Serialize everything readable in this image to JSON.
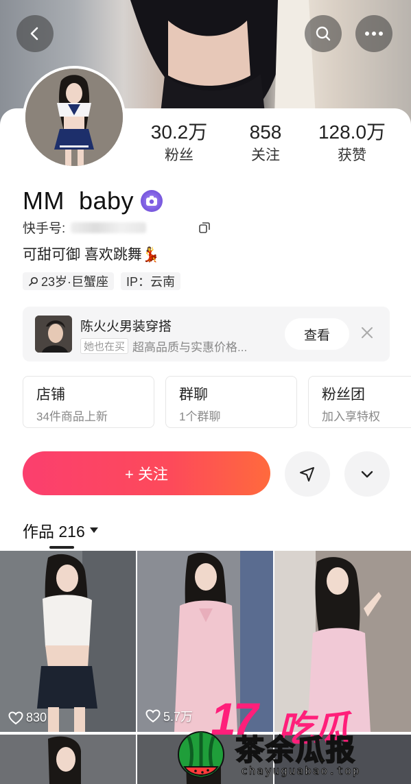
{
  "nav": {
    "back_icon": "chevron-left-icon",
    "search_icon": "search-icon",
    "more_icon": "more-horizontal-icon"
  },
  "stats": [
    {
      "value": "30.2万",
      "label": "粉丝"
    },
    {
      "value": "858",
      "label": "关注"
    },
    {
      "value": "128.0万",
      "label": "获赞"
    }
  ],
  "profile": {
    "name": "MM  baby",
    "badge_icon": "verified-camera-badge-icon",
    "id_label": "快手号:",
    "bio": "可甜可御 喜欢跳舞💃",
    "tags": [
      "23岁·巨蟹座",
      "IP：云南"
    ]
  },
  "banner": {
    "title": "陈火火男装穿搭",
    "pill": "她也在买",
    "subtitle": "超高品质与实惠价格...",
    "view_label": "查看"
  },
  "quick_cards": [
    {
      "title": "店铺",
      "sub": "34件商品上新"
    },
    {
      "title": "群聊",
      "sub": "1个群聊"
    },
    {
      "title": "粉丝团",
      "sub": "加入享特权"
    }
  ],
  "actions": {
    "follow_label": "+ 关注"
  },
  "works": {
    "label": "作品 216",
    "items": [
      {
        "likes": "830",
        "colors": [
          "#6e7378",
          "#e9e7e3"
        ]
      },
      {
        "likes": "5.7万",
        "colors": [
          "#8a8c92",
          "#f2c7cf"
        ]
      },
      {
        "likes": "",
        "colors": [
          "#9a8f87",
          "#f1c9d6"
        ]
      }
    ]
  },
  "watermark": {
    "number": "17",
    "zh1": "吃瓜",
    "zh2": "茶余瓜报",
    "url": "chayuguabao.top"
  },
  "colors": {
    "follow_gradient_start": "#fb3f6e",
    "follow_gradient_end": "#ff6a3d",
    "badge": "#7c5ce0"
  }
}
